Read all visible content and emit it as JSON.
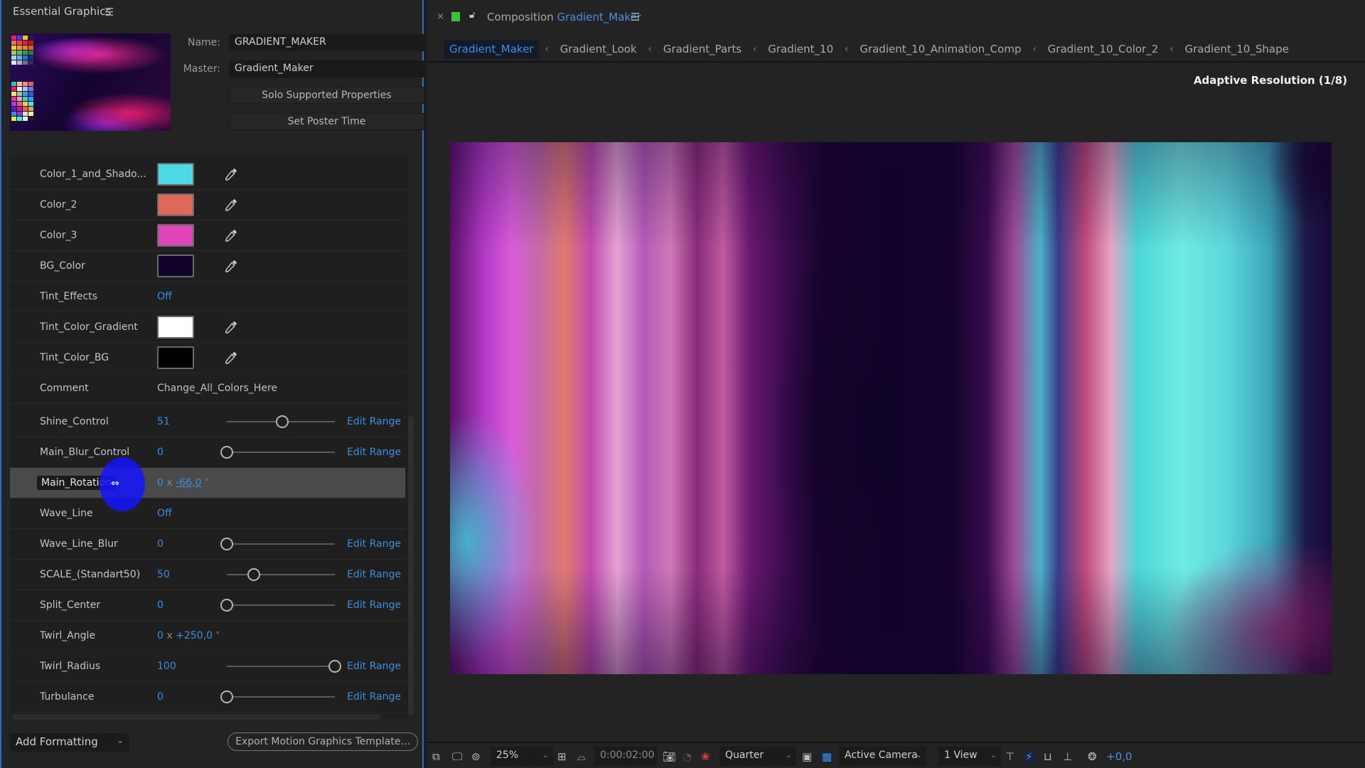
{
  "left_panel": {
    "title": "Essential Graphics",
    "menu_icon": "hamburger-menu-icon",
    "name_label": "Name:",
    "name_value": "GRADIENT_MAKER",
    "master_label": "Master:",
    "master_value": "Gradient_Maker",
    "solo_button": "Solo Supported Properties",
    "poster_button": "Set Poster Time",
    "properties": [
      {
        "label": "Color_1_and_Shado...",
        "type": "color",
        "color": "#4dd8e6"
      },
      {
        "label": "Color_2",
        "type": "color",
        "color": "#e0685a"
      },
      {
        "label": "Color_3",
        "type": "color",
        "color": "#e046b9"
      },
      {
        "label": "BG_Color",
        "type": "color",
        "color": "#100228"
      },
      {
        "label": "Tint_Effects",
        "type": "checkbox",
        "value": "Off"
      },
      {
        "label": "Tint_Color_Gradient",
        "type": "color",
        "color": "#ffffff"
      },
      {
        "label": "Tint_Color_BG",
        "type": "color",
        "color": "#000000"
      },
      {
        "label": "Comment",
        "type": "text",
        "value": "Change_All_Colors_Here"
      },
      {
        "label": "Shine_Control",
        "type": "slider",
        "value": "51",
        "fraction": 0.51,
        "edit": "Edit Range"
      },
      {
        "label": "Main_Blur_Control",
        "type": "slider",
        "value": "0",
        "fraction": 0,
        "edit": "Edit Range"
      },
      {
        "label": "Main_Rotation",
        "type": "angle",
        "revolutions": "0",
        "x": "x",
        "degrees": "-66,0",
        "deg_symbol": "°",
        "selected": true
      },
      {
        "label": "Wave_Line",
        "type": "checkbox",
        "value": "Off"
      },
      {
        "label": "Wave_Line_Blur",
        "type": "slider",
        "value": "0",
        "fraction": 0,
        "edit": "Edit Range"
      },
      {
        "label": "SCALE_(Standart50)",
        "type": "slider",
        "value": "50",
        "fraction": 0.25,
        "edit": "Edit Range"
      },
      {
        "label": "Split_Center",
        "type": "slider",
        "value": "0",
        "fraction": 0,
        "edit": "Edit Range"
      },
      {
        "label": "Twirl_Angle",
        "type": "angle",
        "revolutions": "0",
        "x": "x",
        "degrees": "+250,0",
        "deg_symbol": "°"
      },
      {
        "label": "Twirl_Radius",
        "type": "slider",
        "value": "100",
        "fraction": 1.0,
        "edit": "Edit Range"
      },
      {
        "label": "Turbulance",
        "type": "slider",
        "value": "0",
        "fraction": 0,
        "edit": "Edit Range"
      }
    ],
    "add_formatting": "Add Formatting",
    "export_button": "Export Motion Graphics Template..."
  },
  "composition": {
    "close": "×",
    "prefix": "Composition",
    "name": "Gradient_Maker",
    "label_color": "#3cc23c",
    "breadcrumbs": [
      "Gradient_Maker",
      "Gradient_Look",
      "Gradient_Parts",
      "Gradient_10",
      "Gradient_10_Animation_Comp",
      "Gradient_10_Color_2",
      "Gradient_10_Shape"
    ],
    "breadcrumb_sep": "‹",
    "adaptive_resolution": "Adaptive Resolution (1/8)"
  },
  "viewer_toolbar": {
    "zoom": "25%",
    "timecode": "0:00:02:00",
    "resolution": "Quarter",
    "camera": "Active Camera",
    "views": "1 View",
    "exposure": "+0,0"
  }
}
